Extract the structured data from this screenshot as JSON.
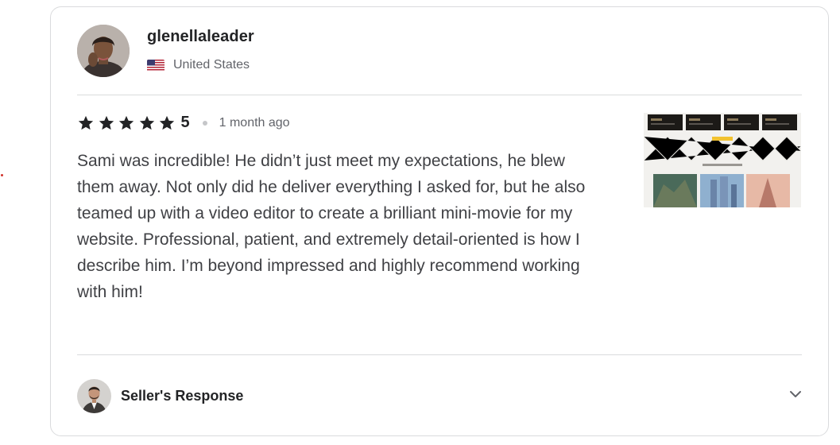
{
  "reviewer": {
    "name": "glenellaleader",
    "country": "United States",
    "avatar_icon": "user-avatar-photo",
    "flag_icon": "us-flag-icon"
  },
  "rating": {
    "stars": 5,
    "score": "5",
    "time_ago": "1 month ago",
    "star_color": "#222325"
  },
  "review": {
    "text": "Sami was incredible! He didn’t just meet my expectations, he blew them away. Not only did he deliver everything I asked for, but he also teamed up with a video editor to create a brilliant mini-movie for my website. Professional, patient, and extremely detail-oriented is how I describe him. I’m beyond impressed and highly recommend working with him!",
    "thumbnail_icon": "portfolio-thumbnail-image"
  },
  "seller_response": {
    "label": "Seller's Response",
    "expand_icon": "chevron-down-icon"
  }
}
